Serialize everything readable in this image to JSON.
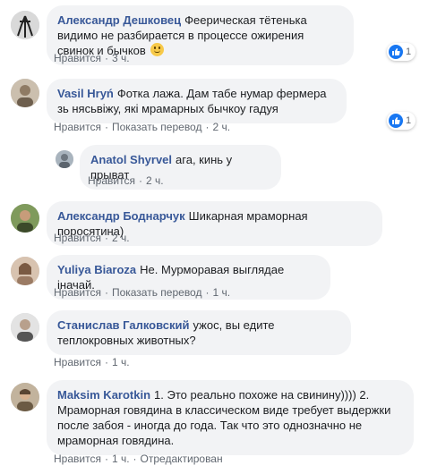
{
  "comments": [
    {
      "author": "Александр Дешковец",
      "text": "Феерическая тётенька видимо не разбирается в процессе ожирения свинок и бычков",
      "emoji": "smile-emoji",
      "like": "Нравится",
      "time": "3 ч.",
      "reactions": "1",
      "avatar_color": "#3a3a3a"
    },
    {
      "author": "Vasil Hryń",
      "text": "Фотка лажа. Дам табе нумар фермера зь нясьвіжу, які мрамарных бычкоу гадуя",
      "like": "Нравится",
      "translate": "Показать перевод",
      "time": "2 ч.",
      "reactions": "1",
      "avatar_color": "#b8a792"
    },
    {
      "author": "Anatol Shyrvel",
      "text": "ага, кинь у прыват",
      "like": "Нравится",
      "time": "2 ч.",
      "avatar_color": "#8e9aa6"
    },
    {
      "author": "Александр Боднарчук",
      "text": "Шикарная мраморная поросятина)",
      "like": "Нравится",
      "time": "2 ч.",
      "avatar_color": "#4e6a3b"
    },
    {
      "author": "Yuliya Biaroza",
      "text": "Не. Мурморавая выглядае іначай.",
      "like": "Нравится",
      "translate": "Показать перевод",
      "time": "1 ч.",
      "avatar_color": "#a98a72"
    },
    {
      "author": "Станислав Галковский",
      "text": "ужос, вы едите теплокровных животных?",
      "like": "Нравится",
      "time": "1 ч.",
      "avatar_color": "#8c8c8c"
    },
    {
      "author": "Maksim Karotkin",
      "text": "1. Это реально похоже на свинину)))) 2. Мраморная говядина в классическом виде требует выдержки после забоя - иногда до года. Так что это однозначно не мраморная говядина.",
      "like": "Нравится",
      "time": "1 ч.",
      "edited": "Отредактирован",
      "avatar_color": "#7a6a55"
    }
  ],
  "colors": {
    "author": "#385898",
    "bubble": "#f2f3f5",
    "meta": "#606770",
    "like_blue": "#1877f2"
  }
}
